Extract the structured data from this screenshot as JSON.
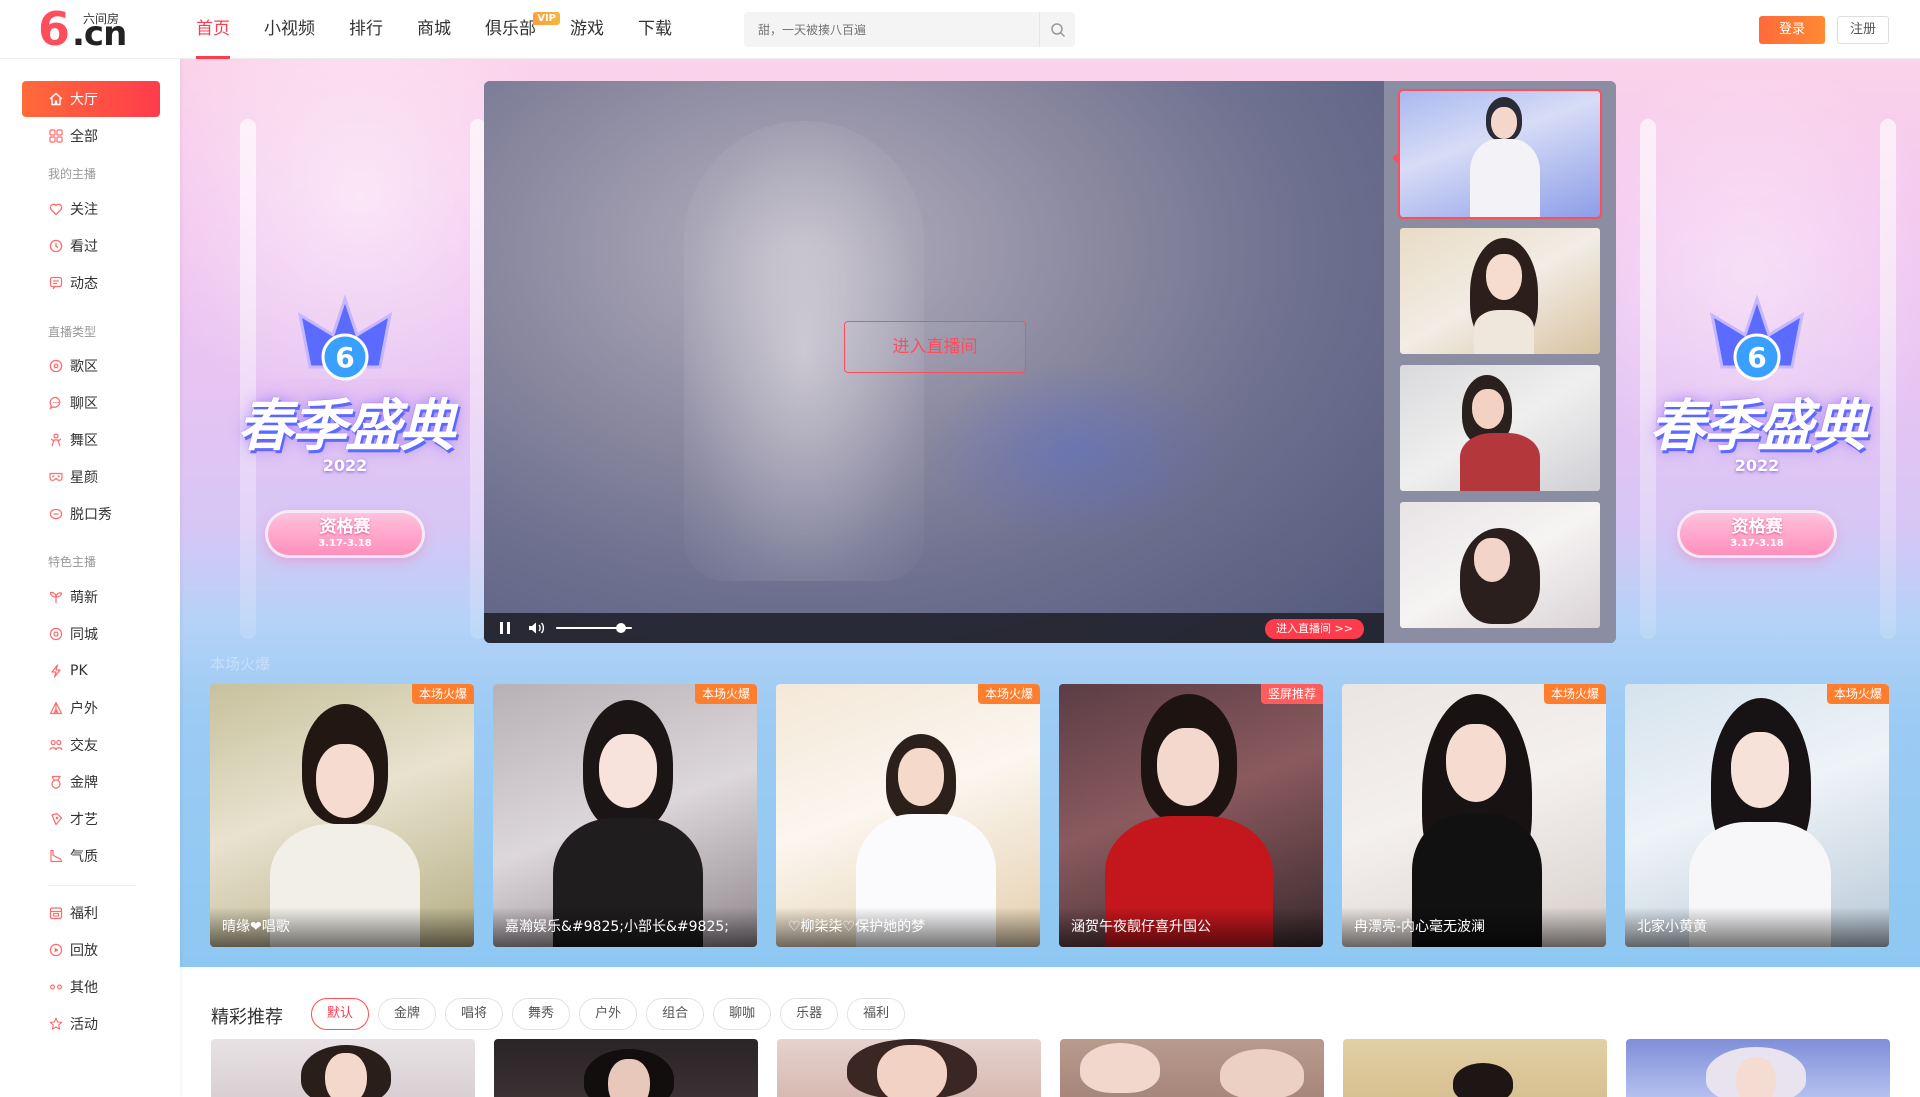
{
  "logo": {
    "mark": "6",
    "domain": ".cn",
    "name": "六间房"
  },
  "nav": {
    "items": [
      {
        "label": "首页",
        "active": true
      },
      {
        "label": "小视频"
      },
      {
        "label": "排行"
      },
      {
        "label": "商城"
      },
      {
        "label": "俱乐部",
        "badge": "VIP"
      },
      {
        "label": "游戏"
      },
      {
        "label": "下载"
      }
    ]
  },
  "search": {
    "placeholder": "甜，一天被揍八百遍"
  },
  "auth": {
    "login": "登录",
    "register": "注册"
  },
  "sidebar": {
    "items": [
      {
        "label": "大厅",
        "icon": "home-icon",
        "active": true
      },
      {
        "label": "全部",
        "icon": "grid-icon"
      },
      {
        "group": "我的主播"
      },
      {
        "label": "关注",
        "icon": "heart-icon"
      },
      {
        "label": "看过",
        "icon": "clock-icon"
      },
      {
        "label": "动态",
        "icon": "feed-icon"
      },
      {
        "group": "直播类型"
      },
      {
        "label": "歌区",
        "icon": "music-icon"
      },
      {
        "label": "聊区",
        "icon": "chat-icon"
      },
      {
        "label": "舞区",
        "icon": "dance-icon"
      },
      {
        "label": "星颜",
        "icon": "mask-icon"
      },
      {
        "label": "脱口秀",
        "icon": "mic-icon"
      },
      {
        "group": "特色主播"
      },
      {
        "label": "萌新",
        "icon": "sprout-icon"
      },
      {
        "label": "同城",
        "icon": "location-icon"
      },
      {
        "label": "PK",
        "icon": "lightning-icon"
      },
      {
        "label": "户外",
        "icon": "tent-icon"
      },
      {
        "label": "交友",
        "icon": "people-icon"
      },
      {
        "label": "金牌",
        "icon": "medal-icon"
      },
      {
        "label": "才艺",
        "icon": "note-icon"
      },
      {
        "label": "气质",
        "icon": "heel-icon"
      },
      {
        "separator": true
      },
      {
        "label": "福利",
        "icon": "gift-icon"
      },
      {
        "label": "回放",
        "icon": "replay-icon"
      },
      {
        "label": "其他",
        "icon": "more-icon"
      },
      {
        "label": "活动",
        "icon": "star-icon"
      }
    ]
  },
  "hero": {
    "event": {
      "title": "春季盛典",
      "year": "2022",
      "stage": "资格赛",
      "dates": "3.17-3.18"
    },
    "player": {
      "enter_label": "进入直播间",
      "enter_small_label": "进入直播间 >>",
      "volume_level": 0.85
    },
    "section_ghost": "本场火爆"
  },
  "hot_cards": [
    {
      "name": "晴缘❤唱歌",
      "tag": "本场火爆"
    },
    {
      "name": "嘉瀚娱乐&#9825;小部长&#9825;",
      "tag": "本场火爆"
    },
    {
      "name": "♡柳柒柒♡保护她的梦",
      "tag": "本场火爆"
    },
    {
      "name": "涵贺午夜靓仔喜升国公",
      "tag": "竖屏推荐"
    },
    {
      "name": "冉漂亮-内心毫无波澜",
      "tag": "本场火爆"
    },
    {
      "name": "北家小黄黄",
      "tag": "本场火爆"
    }
  ],
  "recommend": {
    "title": "精彩推荐",
    "filters": [
      {
        "label": "默认",
        "active": true
      },
      {
        "label": "金牌"
      },
      {
        "label": "唱将"
      },
      {
        "label": "舞秀"
      },
      {
        "label": "户外"
      },
      {
        "label": "组合"
      },
      {
        "label": "聊咖"
      },
      {
        "label": "乐器"
      },
      {
        "label": "福利"
      }
    ]
  },
  "colors": {
    "accent": "#ff3c4c",
    "login_gradient_start": "#ff6a3a",
    "hot_tag": "#ff7e2e",
    "hero_bottom": "#8ec8f2"
  }
}
